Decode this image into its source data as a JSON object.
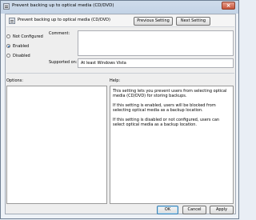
{
  "window": {
    "title": "Prevent backing up to optical media (CD/DVD)",
    "close_label": "×"
  },
  "header": {
    "title": "Prevent backing up to optical media (CD/DVD)"
  },
  "navigation": {
    "previous_label": "Previous Setting",
    "next_label": "Next Setting"
  },
  "options": [
    {
      "label": "Not Configured",
      "selected": false
    },
    {
      "label": "Enabled",
      "selected": true
    },
    {
      "label": "Disabled",
      "selected": false
    }
  ],
  "comment": {
    "label": "Comment:",
    "value": ""
  },
  "supported": {
    "label": "Supported on:",
    "value": "At least Windows Vista"
  },
  "panels": {
    "options_label": "Options:",
    "help_label": "Help:",
    "help_paragraphs": [
      "This setting lets you prevent users from selecting optical media (CD/DVD) for storing backups.",
      "If this setting is enabled, users will be blocked from selecting optical media as a backup location.",
      "If this setting is disabled or not configured, users can select optical media as a backup location."
    ]
  },
  "footer": {
    "ok_label": "OK",
    "cancel_label": "Cancel",
    "apply_label": "Apply"
  }
}
